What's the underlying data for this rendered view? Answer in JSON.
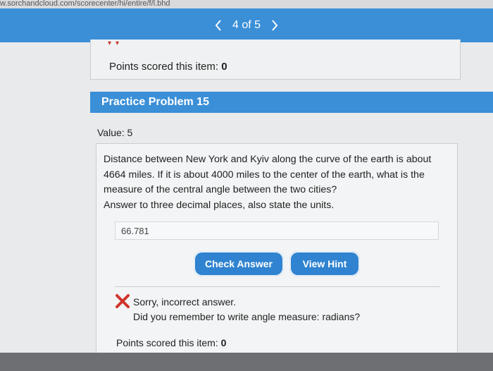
{
  "browser": {
    "url_fragment": "w.sorchandcloud.com/scorecenter/hi/entire/f/l.bhd"
  },
  "pager": {
    "prev_icon": "chevron-left-icon",
    "text": "4 of 5",
    "next_icon": "chevron-right-icon"
  },
  "previous_item": {
    "points_label": "Points scored this item: ",
    "points_value": "0"
  },
  "problem": {
    "title": "Practice Problem 15",
    "value_label": "Value: 5",
    "statement": "Distance between New York and Kyiv along the curve of the earth is about 4664 miles. If it is about 4000 miles to the center of the earth, what is the measure of the central angle between the two cities?",
    "instruction": "Answer to three decimal places, also state the units.",
    "answer_value": "66.781"
  },
  "buttons": {
    "check_answer": "Check Answer",
    "view_hint": "View Hint"
  },
  "feedback": {
    "icon": "x-mark-icon",
    "message": "Sorry, incorrect answer.",
    "hint": "Did you remember to write angle measure: radians?",
    "points_label": "Points scored this item: ",
    "points_value": "0"
  },
  "colors": {
    "header_blue": "#3a8fd7",
    "button_blue": "#2f83d0",
    "error_red": "#d0342c"
  }
}
